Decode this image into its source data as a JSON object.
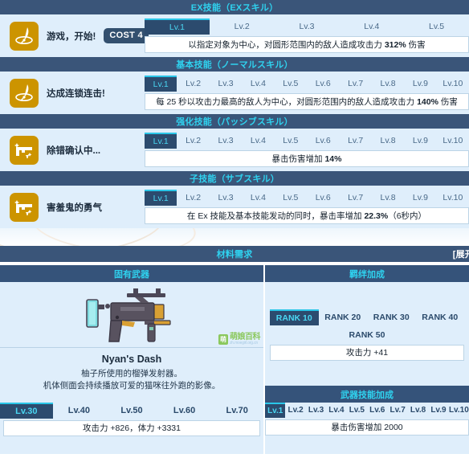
{
  "colors": {
    "header_bar": "#3a5579",
    "header_text": "#2fd2ef",
    "panel_bg": "#dfeefb",
    "tab_active_bg": "#2c4b6e",
    "tab_active_text": "#4ad6f2",
    "tab_accent": "#2ac6e8",
    "icon_bg": "#cc9400",
    "cost_pill_bg": "#33506f"
  },
  "sections": [
    {
      "title": "EX技能（EXスキル）",
      "icon": "crescent-lasso-icon",
      "skill_name": "游戏，开始!",
      "cost": "COST 4",
      "levels": [
        "Lv.1",
        "Lv.2",
        "Lv.3",
        "Lv.4",
        "Lv.5"
      ],
      "active_level": "Lv.1",
      "description_pre": "以指定对象为中心，对圆形范围内的敌人造成攻击力 ",
      "description_value": "312%",
      "description_post": " 伤害"
    },
    {
      "title": "基本技能（ノーマルスキル）",
      "icon": "crescent-lasso-icon",
      "skill_name": "达成连锁连击!",
      "cost": "",
      "levels": [
        "Lv.1",
        "Lv.2",
        "Lv.3",
        "Lv.4",
        "Lv.5",
        "Lv.6",
        "Lv.7",
        "Lv.8",
        "Lv.9",
        "Lv.10"
      ],
      "active_level": "Lv.1",
      "description_pre": "每 25 秒以攻击力最高的敌人为中心，对圆形范围内的敌人造成攻击力 ",
      "description_value": "140%",
      "description_post": " 伤害"
    },
    {
      "title": "强化技能（パッシブスキル）",
      "icon": "sparkle-pistol-icon",
      "skill_name": "除错确认中...",
      "cost": "",
      "levels": [
        "Lv.1",
        "Lv.2",
        "Lv.3",
        "Lv.4",
        "Lv.5",
        "Lv.6",
        "Lv.7",
        "Lv.8",
        "Lv.9",
        "Lv.10"
      ],
      "active_level": "Lv.1",
      "description_pre": "暴击伤害增加 ",
      "description_value": "14%",
      "description_post": ""
    },
    {
      "title": "子技能（サブスキル）",
      "icon": "sparkle-pistol-icon",
      "skill_name": "害羞鬼的勇气",
      "cost": "",
      "levels": [
        "Lv.1",
        "Lv.2",
        "Lv.3",
        "Lv.4",
        "Lv.5",
        "Lv.6",
        "Lv.7",
        "Lv.8",
        "Lv.9",
        "Lv.10"
      ],
      "active_level": "Lv.1",
      "description_pre": "在 Ex 技能及基本技能发动的同时，暴击率增加 ",
      "description_value": "22.3%",
      "description_post": "（6秒内）"
    }
  ],
  "materials": {
    "title": "材料需求",
    "expand_label": "[展开"
  },
  "weapon": {
    "panel_title": "固有武器",
    "name": "Nyan's Dash",
    "desc_line1": "柚子所使用的榴弹发射器。",
    "desc_line2": "机体侧面会持续播放可爱的猫咪往外跑的影像。",
    "levels": [
      "Lv.30",
      "Lv.40",
      "Lv.50",
      "Lv.60",
      "Lv.70"
    ],
    "active_level": "Lv.30",
    "stat_line": "攻击力 +826，体力 +3331"
  },
  "watermark": {
    "badge": "萌",
    "name": "萌娘百科",
    "url": "zh.moegirl.org.cn"
  },
  "bond": {
    "panel_title": "羁绊加成",
    "ranks_row1": [
      "RANK 10",
      "RANK 20",
      "RANK 30",
      "RANK 40"
    ],
    "ranks_row2": [
      "RANK 50"
    ],
    "active_rank": "RANK 10",
    "stat_line": "攻击力 +41"
  },
  "weapon_skill": {
    "panel_title": "武器技能加成",
    "levels": [
      "Lv.1",
      "Lv.2",
      "Lv.3",
      "Lv.4",
      "Lv.5",
      "Lv.6",
      "Lv.7",
      "Lv.8",
      "Lv.9",
      "Lv.10"
    ],
    "active_level": "Lv.1",
    "stat_line": "暴击伤害增加 2000"
  }
}
